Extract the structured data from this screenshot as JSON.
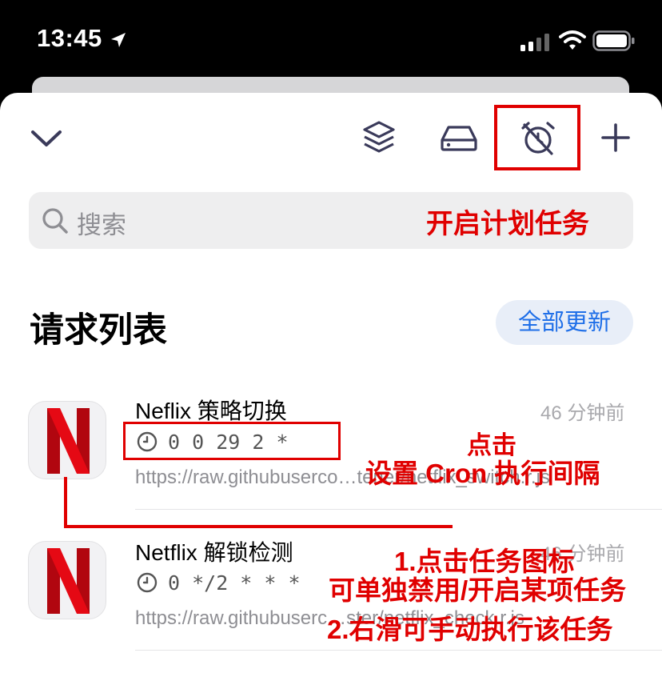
{
  "status_bar": {
    "time": "13:45"
  },
  "search": {
    "placeholder": "搜索"
  },
  "section": {
    "title": "请求列表",
    "update_all_label": "全部更新"
  },
  "items": [
    {
      "name": "Neflix 策略切换",
      "time": "46 分钟前",
      "cron": "0 0 29 2 *",
      "url": "https://raw.githubuserco…tener/netflix_switch.r.js"
    },
    {
      "name": "Netflix 解锁检测",
      "time": "46 分钟前",
      "cron": "0 */2 * * *",
      "url": "https://raw.githubuserc…ster/netflix_check.r.js"
    }
  ],
  "annotations": {
    "enable_schedule": "开启计划任务",
    "click": "点击",
    "set_cron": "设置 Cron 执行间隔",
    "tip1": "1.点击任务图标",
    "tip2": "可单独禁用/开启某项任务",
    "tip3": "2.右滑可手动执行该任务"
  },
  "colors": {
    "accent": "#1f6fe8",
    "annotation_red": "#e00000",
    "netflix_red": "#b1060f"
  },
  "icons": [
    "location-arrow-icon",
    "signal-icon",
    "wifi-icon",
    "battery-icon",
    "chevron-down-icon",
    "layers-icon",
    "drive-icon",
    "alarm-off-icon",
    "plus-icon",
    "search-icon",
    "clock-icon",
    "netflix-logo"
  ]
}
